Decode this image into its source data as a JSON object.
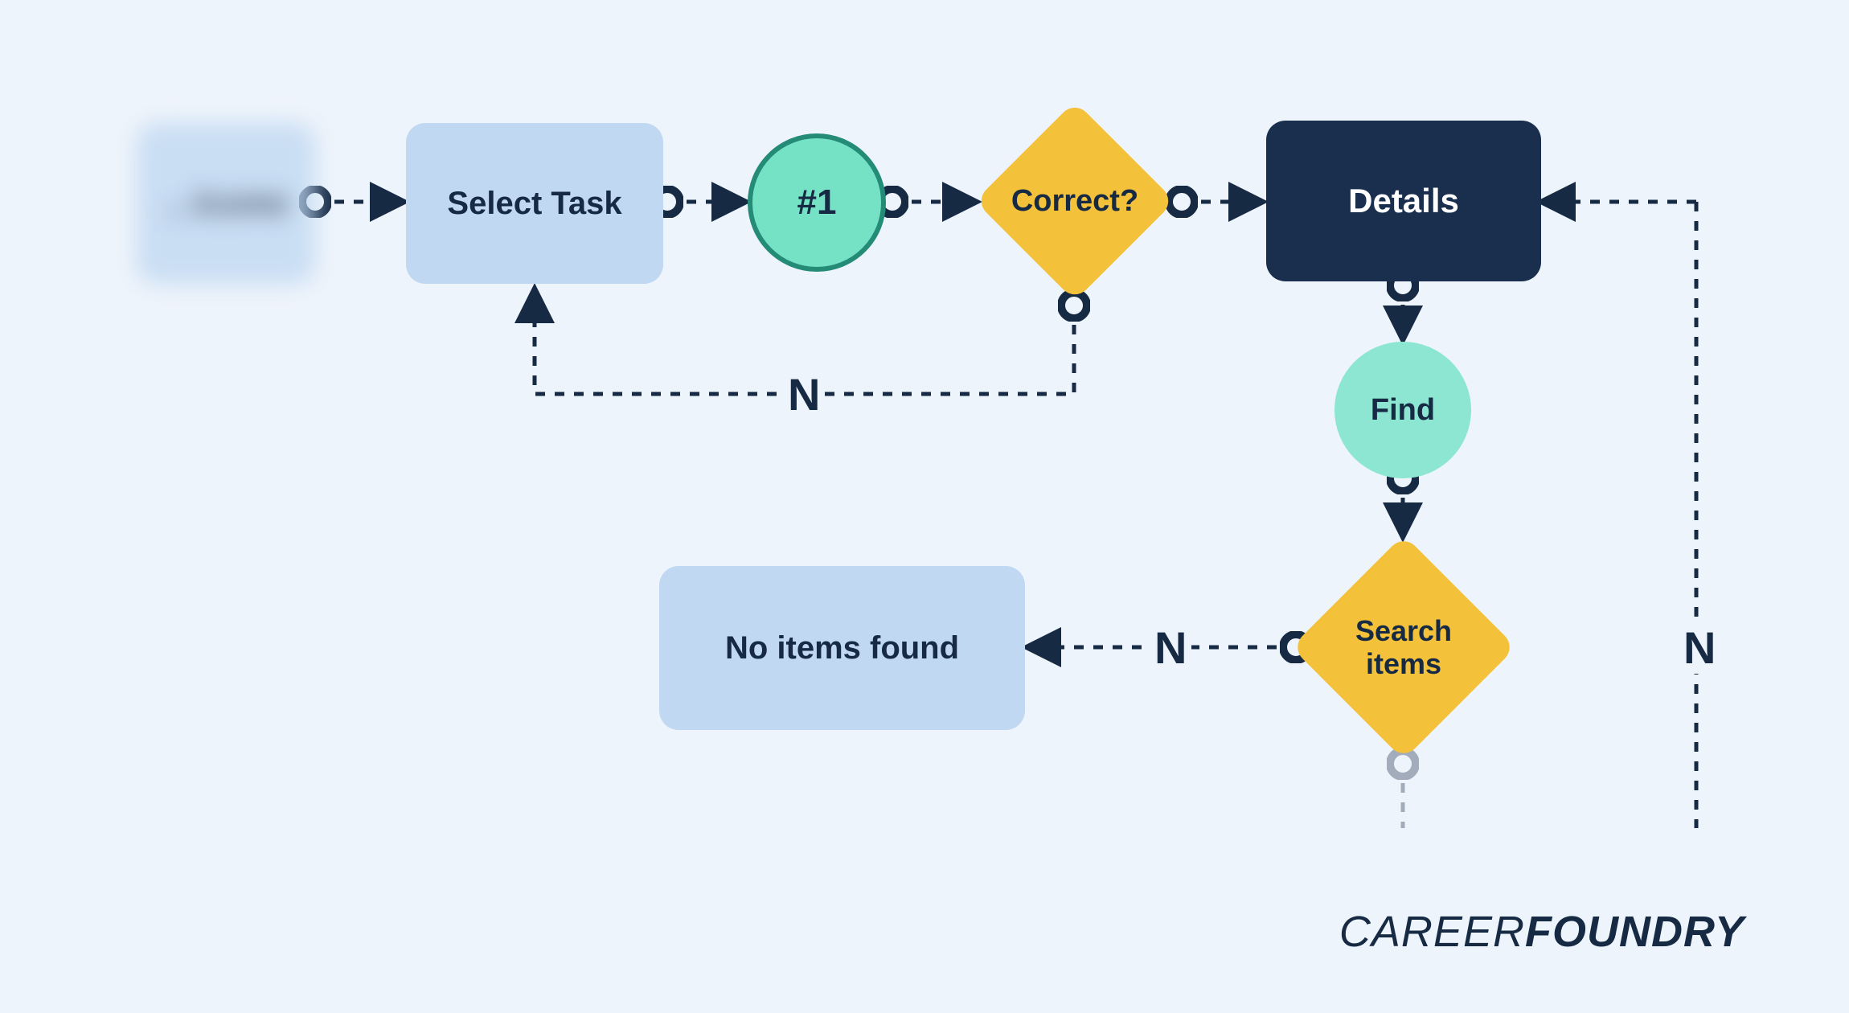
{
  "nodes": {
    "welcome": "…lcome",
    "select_task": "Select Task",
    "step1": "#1",
    "correct": "Correct?",
    "details": "Details",
    "find": "Find",
    "search_items": "Search\nitems",
    "no_items": "No items found"
  },
  "labels": {
    "n1": "N",
    "n2": "N",
    "n3": "N"
  },
  "logo": {
    "part1": "CAREER",
    "part2": "FOUNDRY"
  },
  "colors": {
    "bg": "#eef4fb",
    "light_blue": "#c0d8f2",
    "dark_navy": "#192f4d",
    "teal": "#75e2c6",
    "teal_stroke": "#248b77",
    "teal_flat": "#8ce6d1",
    "amber": "#f4c13a",
    "text_dark": "#172a44"
  }
}
